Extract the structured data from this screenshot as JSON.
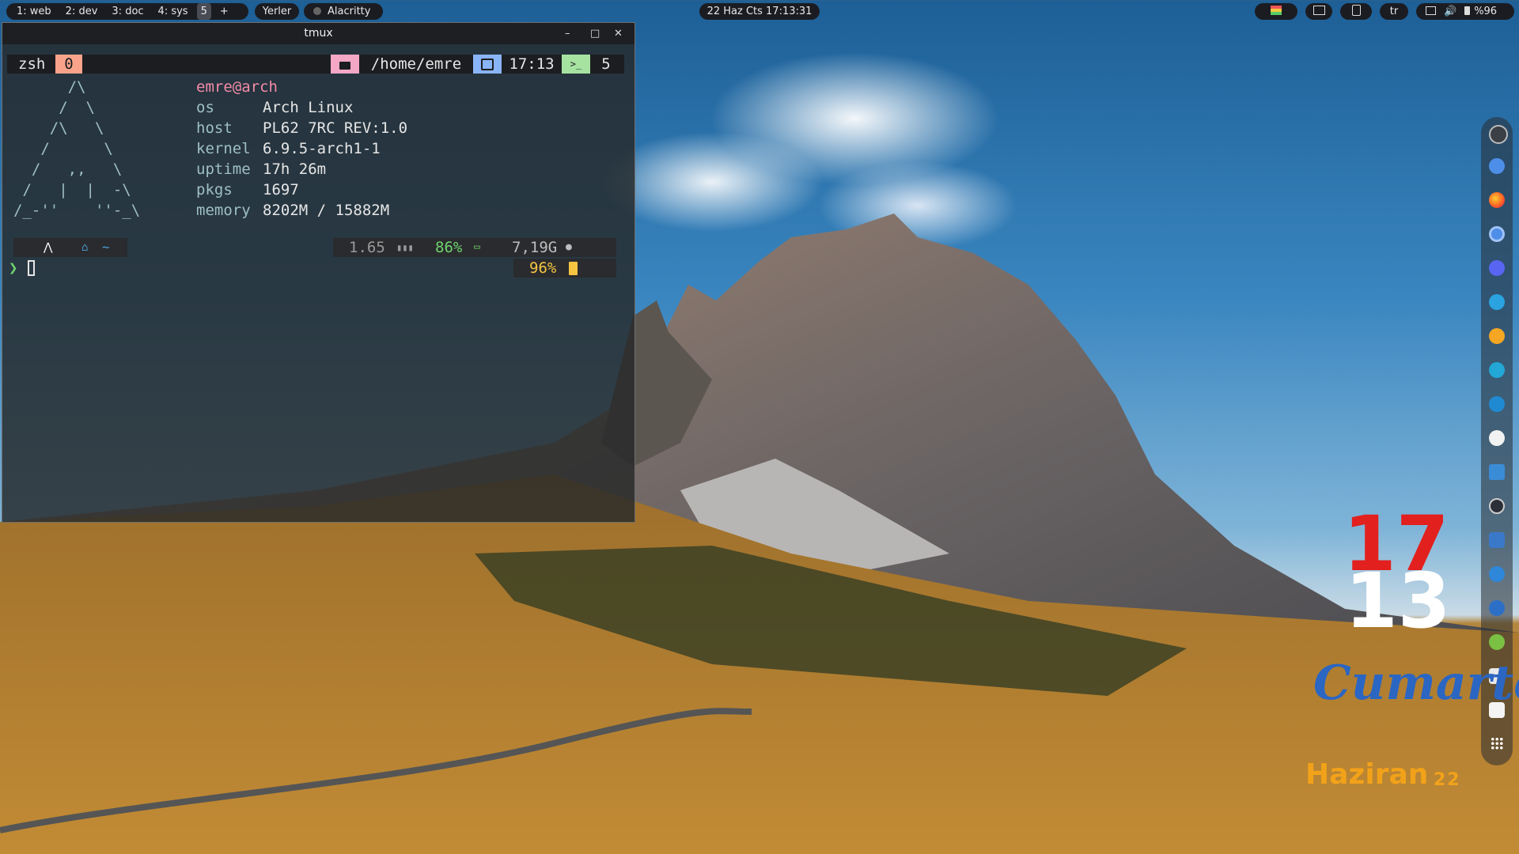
{
  "topbar": {
    "workspaces": [
      "1: web",
      "2: dev",
      "3: doc",
      "4: sys",
      "5",
      "+"
    ],
    "places_label": "Yerler",
    "active_app": "Alacritty",
    "clock": "22 Haz Cts  17:13:31",
    "keyboard_layout": "tr",
    "battery": "%96"
  },
  "terminal": {
    "window_title": "tmux",
    "tmux": {
      "session": "zsh",
      "window_index": "0",
      "path": "/home/emre",
      "time": "17:13",
      "pane_count": "5"
    },
    "fetch": {
      "user": "emre@arch",
      "rows": [
        {
          "key": "os",
          "value": "Arch Linux"
        },
        {
          "key": "host",
          "value": "PL62 7RC REV:1.0"
        },
        {
          "key": "kernel",
          "value": "6.9.5-arch1-1"
        },
        {
          "key": "uptime",
          "value": "17h 26m"
        },
        {
          "key": "pkgs",
          "value": "1697"
        },
        {
          "key": "memory",
          "value": "8202M / 15882M"
        }
      ]
    },
    "prompt": {
      "home_glyph": "~",
      "load": "1.65",
      "cpu": "86%",
      "disk": "7,19G",
      "battery": "96%",
      "arrow": "❯"
    }
  },
  "desktop_widget": {
    "hour": "17",
    "minute": "13",
    "weekday": "Cumartesi",
    "month": "Haziran",
    "day": "22"
  },
  "dock": {
    "apps": [
      "arch-icon",
      "browser-icon",
      "firefox-icon",
      "chromium-icon",
      "discord-icon",
      "telegram-icon",
      "media-player-icon",
      "audio-visualizer-icon",
      "vscode-icon",
      "github-icon",
      "virtual-machine-icon",
      "steam-icon",
      "email-icon",
      "transfer-icon",
      "vpn-icon",
      "android-icon",
      "download-icon",
      "settings-icon",
      "app-grid-icon"
    ]
  },
  "colors": {
    "accent_pink": "#f5a7c6",
    "accent_blue": "#8ab4f8",
    "accent_green": "#a6e3a1",
    "zsh_badge": "#f9a48a",
    "clock_red": "#e2201e",
    "weekday_blue": "#2b66c2",
    "month_orange": "#f2a219"
  }
}
